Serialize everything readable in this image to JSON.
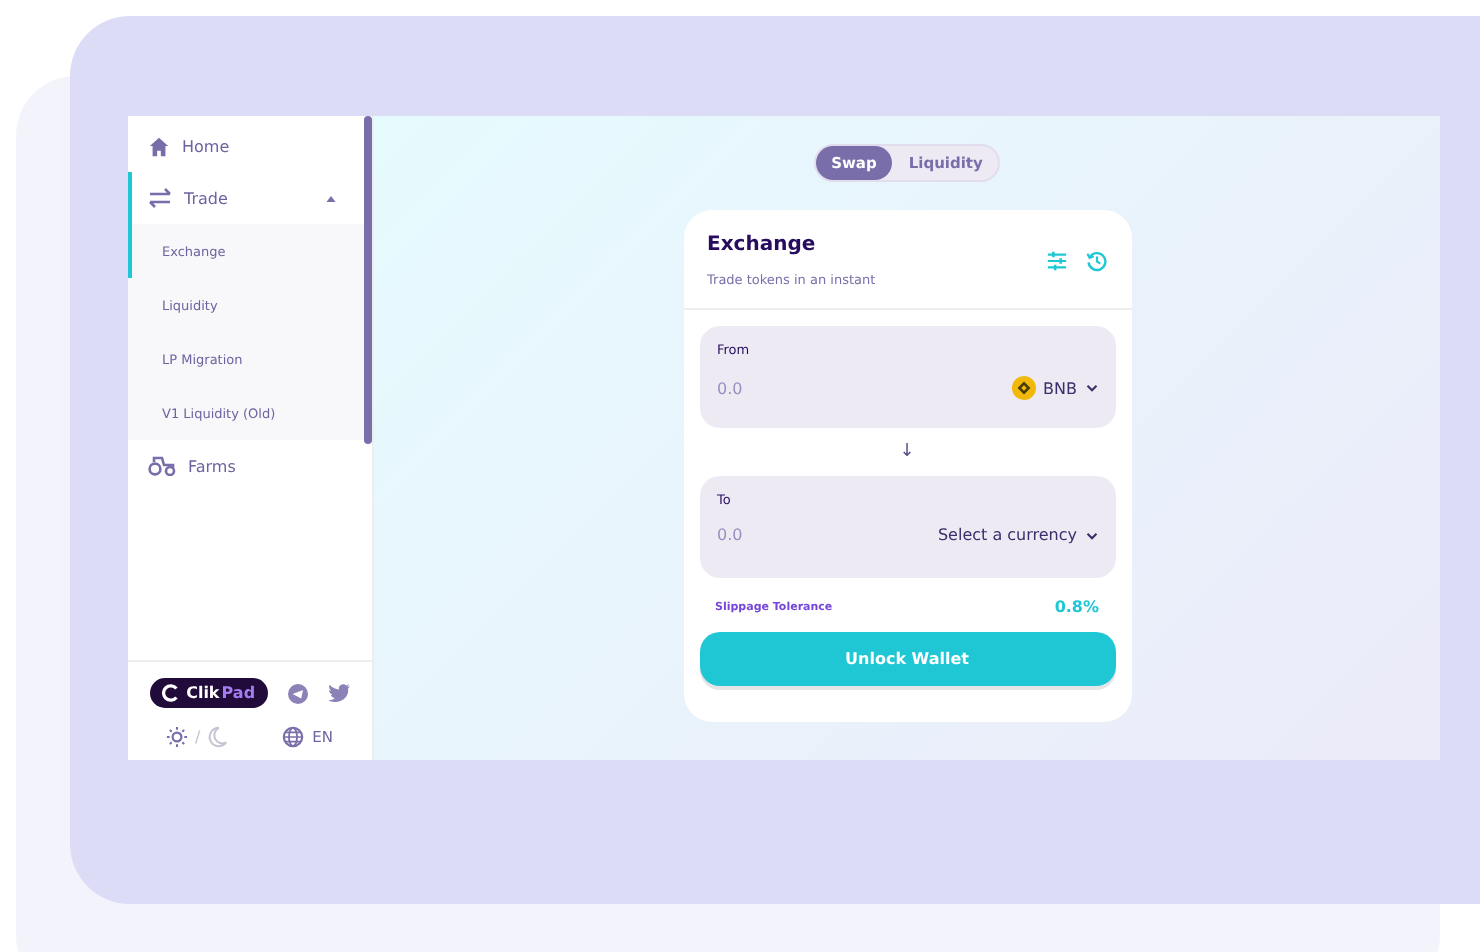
{
  "sidebar": {
    "items": [
      {
        "label": "Home",
        "selected": false
      },
      {
        "label": "Trade",
        "selected": true,
        "expanded": true,
        "children": [
          {
            "label": "Exchange",
            "selected": true
          },
          {
            "label": "Liquidity",
            "selected": false
          },
          {
            "label": "LP Migration",
            "selected": false
          },
          {
            "label": "V1 Liquidity (Old)",
            "selected": false
          }
        ]
      },
      {
        "label": "Farms",
        "selected": false
      }
    ],
    "brand": {
      "prefix": "Clik",
      "suffix": "Pad"
    },
    "theme_separator": "/",
    "language": "EN"
  },
  "tabs": [
    {
      "label": "Swap",
      "selected": true
    },
    {
      "label": "Liquidity",
      "selected": false
    }
  ],
  "card": {
    "title": "Exchange",
    "subtitle": "Trade tokens in an instant",
    "from": {
      "label": "From",
      "placeholder": "0.0",
      "currency": "BNB"
    },
    "arrow": "↓",
    "to": {
      "label": "To",
      "placeholder": "0.0",
      "currency": "Select a currency"
    },
    "slippage_label": "Slippage Tolerance",
    "slippage_value": "0.8%",
    "button": "Unlock Wallet"
  }
}
